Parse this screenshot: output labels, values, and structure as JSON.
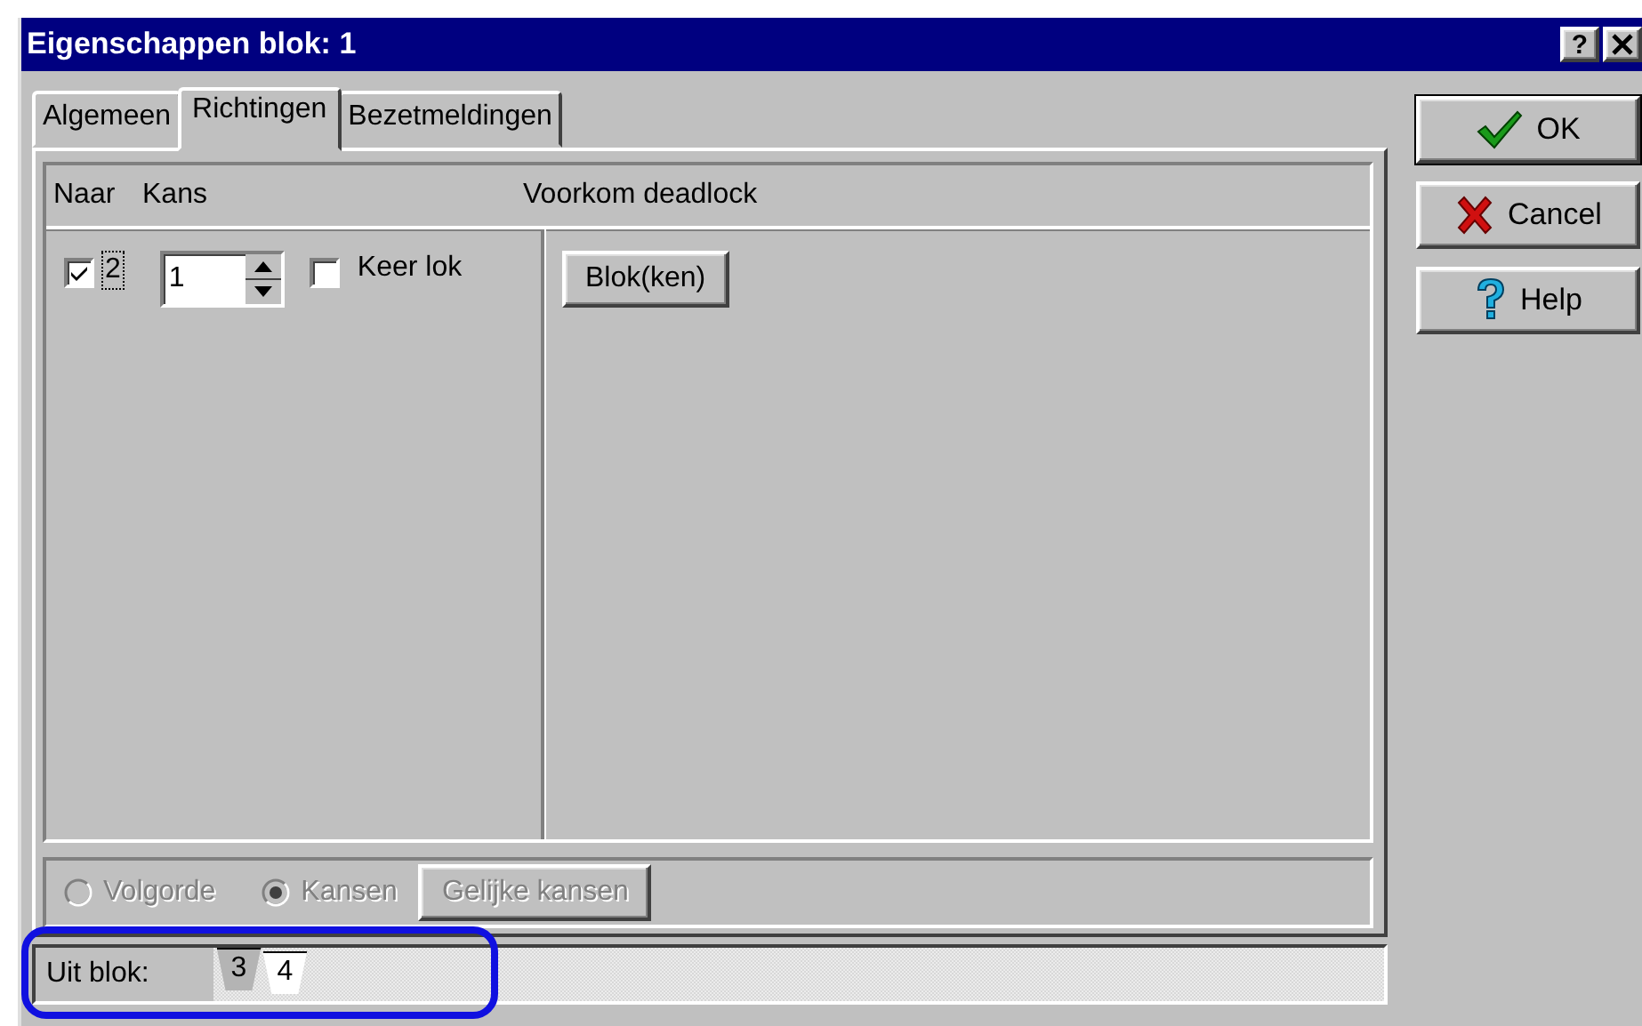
{
  "window": {
    "title": "Eigenschappen blok: 1",
    "help_label": "?"
  },
  "tabs": [
    {
      "label": "Algemeen",
      "selected": false
    },
    {
      "label": "Richtingen",
      "selected": true
    },
    {
      "label": "Bezetmeldingen",
      "selected": false
    }
  ],
  "table": {
    "columns": [
      "Naar",
      "Kans",
      "Voorkom deadlock"
    ],
    "rows": [
      {
        "checked": true,
        "target": "2",
        "kans": "1",
        "keer_lok": {
          "label": "Keer lok",
          "checked": false
        },
        "button": "Blok(ken)"
      }
    ]
  },
  "options": {
    "disabled": true,
    "radios": [
      {
        "label": "Volgorde",
        "selected": false
      },
      {
        "label": "Kansen",
        "selected": true
      }
    ],
    "button": "Gelijke kansen"
  },
  "from_block": {
    "label": "Uit blok:",
    "tabs": [
      {
        "label": "3",
        "selected": false
      },
      {
        "label": "4",
        "selected": true
      }
    ]
  },
  "buttons": [
    {
      "label": "OK",
      "kind": "ok"
    },
    {
      "label": "Cancel",
      "kind": "cancel"
    },
    {
      "label": "Help",
      "kind": "help"
    }
  ]
}
